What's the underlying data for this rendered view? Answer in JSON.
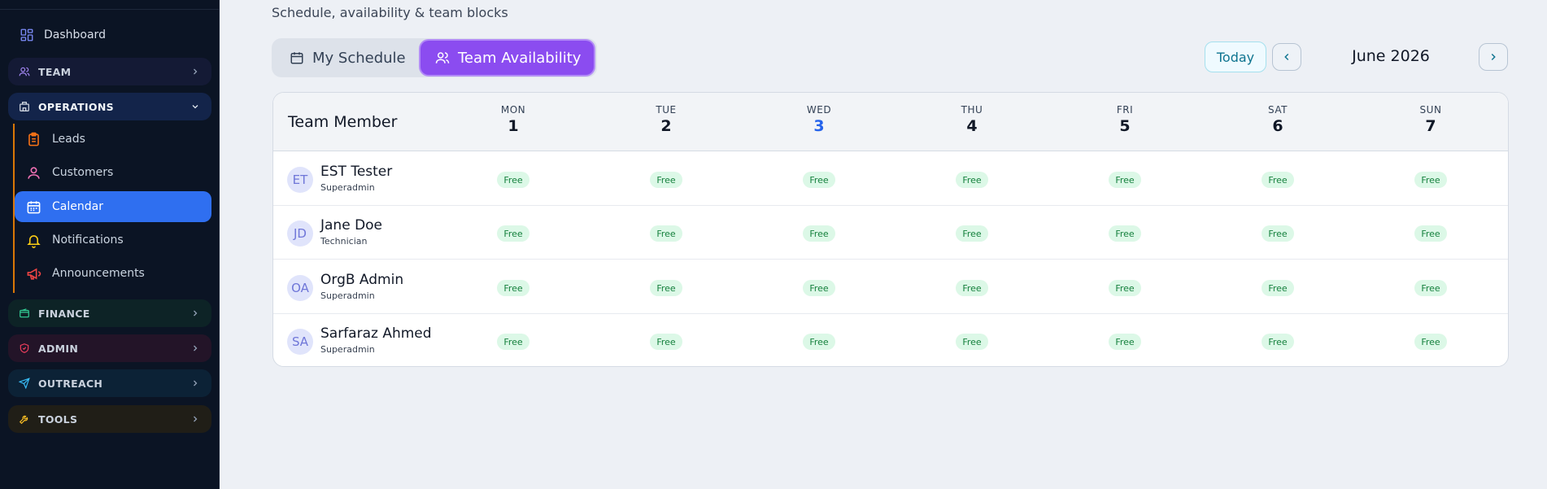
{
  "sidebar": {
    "dashboard_label": "Dashboard",
    "groups": {
      "team": "TEAM",
      "operations": "OPERATIONS",
      "finance": "FINANCE",
      "admin": "ADMIN",
      "outreach": "OUTREACH",
      "tools": "TOOLS"
    },
    "operations_items": {
      "leads": "Leads",
      "customers": "Customers",
      "calendar": "Calendar",
      "notifications": "Notifications",
      "announcements": "Announcements"
    },
    "active_item": "Calendar"
  },
  "header": {
    "subtitle": "Schedule, availability & team blocks"
  },
  "view_toggle": {
    "my_schedule": "My Schedule",
    "team_availability": "Team Availability",
    "active": "Team Availability"
  },
  "date_nav": {
    "today_label": "Today",
    "month_label": "June 2026"
  },
  "table": {
    "member_header": "Team Member",
    "days": [
      {
        "name": "MON",
        "date": "1"
      },
      {
        "name": "TUE",
        "date": "2"
      },
      {
        "name": "WED",
        "date": "3"
      },
      {
        "name": "THU",
        "date": "4"
      },
      {
        "name": "FRI",
        "date": "5"
      },
      {
        "name": "SAT",
        "date": "6"
      },
      {
        "name": "SUN",
        "date": "7"
      }
    ],
    "today_index": 2,
    "members": [
      {
        "initials": "ET",
        "name": "EST Tester",
        "role": "Superadmin",
        "status": [
          "Free",
          "Free",
          "Free",
          "Free",
          "Free",
          "Free",
          "Free"
        ]
      },
      {
        "initials": "JD",
        "name": "Jane Doe",
        "role": "Technician",
        "status": [
          "Free",
          "Free",
          "Free",
          "Free",
          "Free",
          "Free",
          "Free"
        ]
      },
      {
        "initials": "OA",
        "name": "OrgB Admin",
        "role": "Superadmin",
        "status": [
          "Free",
          "Free",
          "Free",
          "Free",
          "Free",
          "Free",
          "Free"
        ]
      },
      {
        "initials": "SA",
        "name": "Sarfaraz Ahmed",
        "role": "Superadmin",
        "status": [
          "Free",
          "Free",
          "Free",
          "Free",
          "Free",
          "Free",
          "Free"
        ]
      }
    ]
  },
  "icons": {
    "dashboard": "grid-icon",
    "team": "users-icon",
    "operations": "building-icon",
    "leads": "clipboard-icon",
    "customers": "user-icon",
    "calendar": "calendar-icon",
    "notifications": "bell-icon",
    "announcements": "megaphone-icon",
    "finance": "wallet-icon",
    "admin": "shield-icon",
    "outreach": "send-icon",
    "tools": "wrench-icon"
  },
  "colors": {
    "sidebar_bg": "#0b1424",
    "active_item": "#2f6ff0",
    "toggle_active": "#8b4cf0",
    "free_badge_bg": "#dcf8e7",
    "free_badge_text": "#15803d",
    "today_date": "#2563eb"
  }
}
